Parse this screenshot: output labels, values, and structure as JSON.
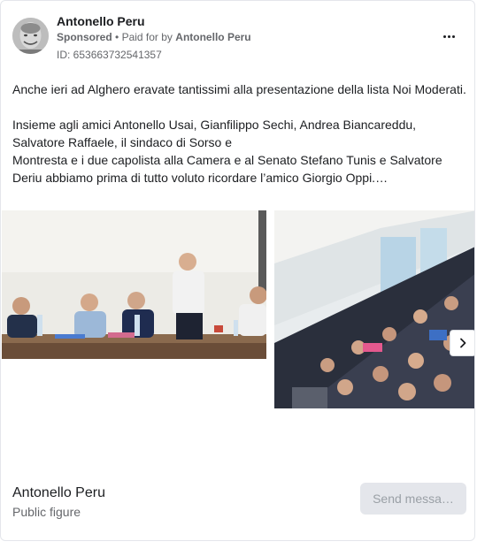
{
  "post": {
    "page_name": "Antonello Peru",
    "sponsored": "Sponsored",
    "separator": "•",
    "paid_for_prefix": "Paid for by",
    "paid_for_name": "Antonello Peru",
    "ad_id": "ID: 653663732541357",
    "more_icon": "more-horizontal-icon",
    "text": {
      "line1": "Anche ieri ad Alghero eravate tantissimi alla presentazione della lista Noi Moderati.",
      "line2": "Insieme agli amici Antonello Usai, Gianfilippo Sechi, Andrea Biancareddu, Salvatore Raffaele, il sindaco di Sorso e",
      "line3": "Montresta e i due capolista alla Camera e al Senato Stefano Tunis e Salvatore Deriu abbiamo prima di tutto voluto ricordare l’amico Giorgio Oppi.…"
    }
  },
  "carousel": {
    "next_icon": "chevron-right-icon"
  },
  "footer": {
    "name": "Antonello Peru",
    "category": "Public figure",
    "button_label": "Send messa…"
  }
}
